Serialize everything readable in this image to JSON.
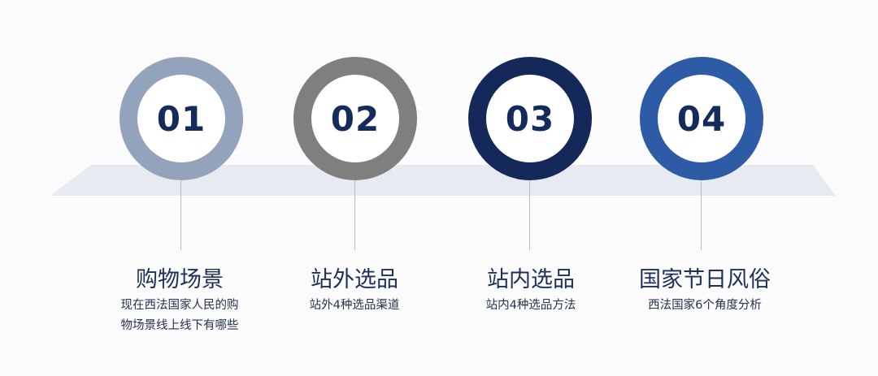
{
  "steps": [
    {
      "number": "01",
      "title": "购物场景",
      "desc_lines": [
        "现在西法国家人民的购",
        "物场景线上线下有哪些"
      ],
      "ring_color": "#94a3bc"
    },
    {
      "number": "02",
      "title": "站外选品",
      "desc_lines": [
        "站外4种选品渠道"
      ],
      "ring_color": "#7f7f7f"
    },
    {
      "number": "03",
      "title": "站内选品",
      "desc_lines": [
        "站内4种选品方法"
      ],
      "ring_color": "#14285a"
    },
    {
      "number": "04",
      "title": "国家节日风俗",
      "desc_lines": [
        "西法国家6个角度分析"
      ],
      "ring_color": "#2d5ba6"
    }
  ],
  "colors": {
    "band": "#e7eaf0",
    "number_text": "#142c5c",
    "title_text": "#1d3158",
    "stem": "#b9bdc6"
  }
}
